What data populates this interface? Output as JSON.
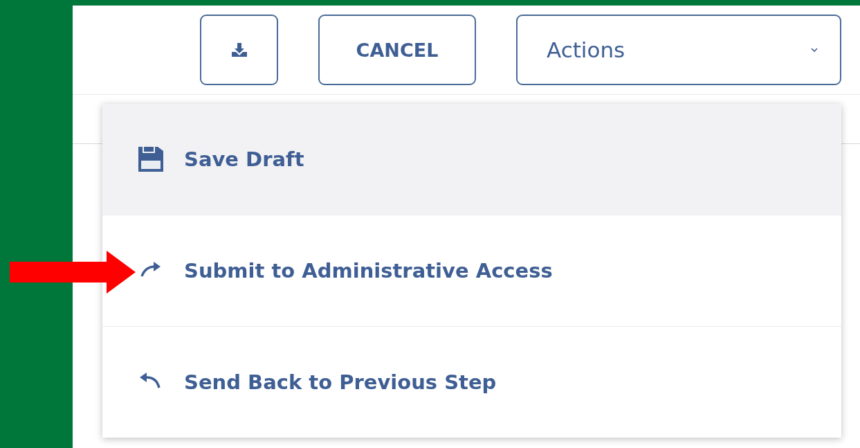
{
  "toolbar": {
    "cancel_label": "CANCEL",
    "actions_label": "Actions",
    "actions_expanded": true
  },
  "menu": {
    "items": [
      {
        "label": "Save Draft",
        "kind": "save",
        "selected": true
      },
      {
        "label": "Submit to Administrative Access",
        "kind": "forward",
        "selected": false
      },
      {
        "label": "Send Back to Previous Step",
        "kind": "back",
        "selected": false
      }
    ]
  }
}
